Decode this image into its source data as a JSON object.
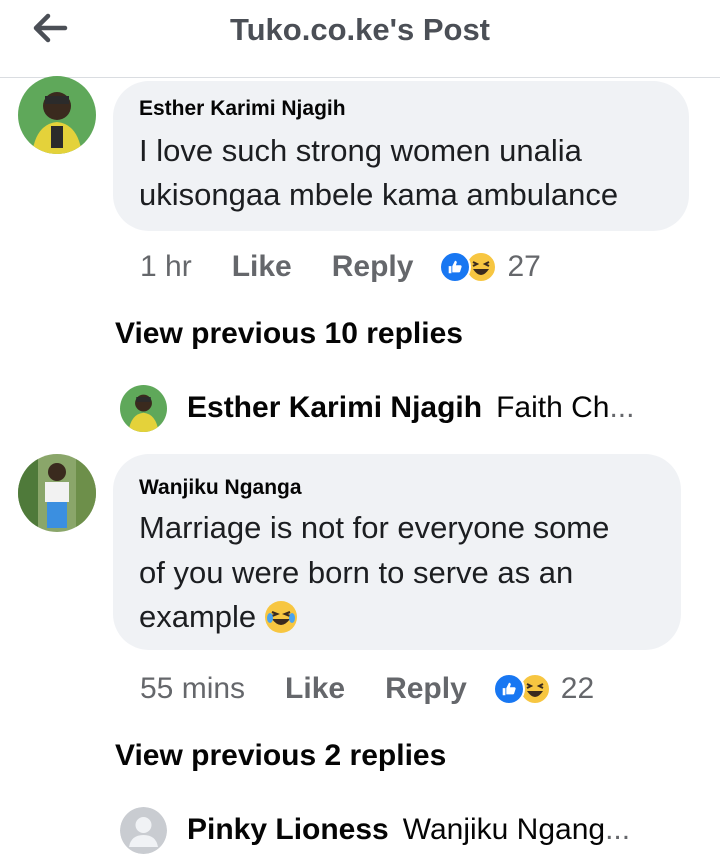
{
  "header": {
    "title": "Tuko.co.ke's Post"
  },
  "comments": [
    {
      "author": "Esther Karimi Njagih",
      "text_lines": [
        "I love such strong women unalia",
        "ukisongaa mbele kama ambulance"
      ],
      "time": "1 hr",
      "like_label": "Like",
      "reply_label": "Reply",
      "reaction_count": "27",
      "view_previous": "View previous 10 replies",
      "latest_reply": {
        "author": "Esther Karimi Njagih",
        "snippet": "Faith Ch",
        "ellipsis": "..."
      }
    },
    {
      "author": "Wanjiku Nganga",
      "text_lines": [
        "Marriage is not for everyone some",
        "of you were born to serve as an",
        "example"
      ],
      "emoji": "laughing-face-icon",
      "time": "55 mins",
      "like_label": "Like",
      "reply_label": "Reply",
      "reaction_count": "22",
      "view_previous": "View previous 2 replies",
      "latest_reply": {
        "author": "Pinky Lioness",
        "snippet": "Wanjiku Ngang",
        "ellipsis": "..."
      }
    }
  ],
  "colors": {
    "like_blue": "#1877f2",
    "bubble_gray": "#f0f2f5",
    "meta_gray": "#65676b",
    "haha_yellow": "#f7c641"
  }
}
